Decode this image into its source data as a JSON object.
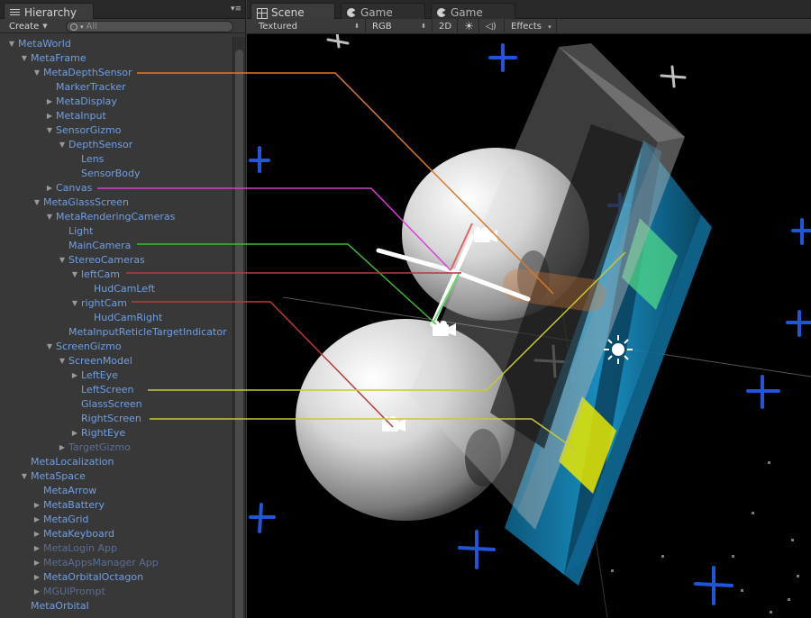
{
  "hierarchy": {
    "tab_label": "Hierarchy",
    "create_label": "Create",
    "search_placeholder": "All",
    "rows": [
      {
        "label": "MetaWorld",
        "depth": 0,
        "arrow": "open"
      },
      {
        "label": "MetaFrame",
        "depth": 1,
        "arrow": "open"
      },
      {
        "label": "MetaDepthSensor",
        "depth": 2,
        "arrow": "open"
      },
      {
        "label": "MarkerTracker",
        "depth": 3,
        "arrow": "none"
      },
      {
        "label": "MetaDisplay",
        "depth": 3,
        "arrow": "closed"
      },
      {
        "label": "MetaInput",
        "depth": 3,
        "arrow": "closed"
      },
      {
        "label": "SensorGizmo",
        "depth": 3,
        "arrow": "open"
      },
      {
        "label": "DepthSensor",
        "depth": 4,
        "arrow": "open"
      },
      {
        "label": "Lens",
        "depth": 5,
        "arrow": "none"
      },
      {
        "label": "SensorBody",
        "depth": 5,
        "arrow": "none"
      },
      {
        "label": "Canvas",
        "depth": 3,
        "arrow": "closed"
      },
      {
        "label": "MetaGlassScreen",
        "depth": 2,
        "arrow": "open"
      },
      {
        "label": "MetaRenderingCameras",
        "depth": 3,
        "arrow": "open"
      },
      {
        "label": "Light",
        "depth": 4,
        "arrow": "none"
      },
      {
        "label": "MainCamera",
        "depth": 4,
        "arrow": "none"
      },
      {
        "label": "StereoCameras",
        "depth": 4,
        "arrow": "open"
      },
      {
        "label": "leftCam",
        "depth": 5,
        "arrow": "open"
      },
      {
        "label": "HudCamLeft",
        "depth": 6,
        "arrow": "none"
      },
      {
        "label": "rightCam",
        "depth": 5,
        "arrow": "open"
      },
      {
        "label": "HudCamRight",
        "depth": 6,
        "arrow": "none"
      },
      {
        "label": "MetaInputReticleTargetIndicator",
        "depth": 4,
        "arrow": "none"
      },
      {
        "label": "ScreenGizmo",
        "depth": 3,
        "arrow": "open"
      },
      {
        "label": "ScreenModel",
        "depth": 4,
        "arrow": "open"
      },
      {
        "label": "LeftEye",
        "depth": 5,
        "arrow": "closed"
      },
      {
        "label": "LeftScreen",
        "depth": 5,
        "arrow": "none"
      },
      {
        "label": "GlassScreen",
        "depth": 5,
        "arrow": "none"
      },
      {
        "label": "RightScreen",
        "depth": 5,
        "arrow": "none"
      },
      {
        "label": "RightEye",
        "depth": 5,
        "arrow": "closed"
      },
      {
        "label": "TargetGizmo",
        "depth": 4,
        "arrow": "closed",
        "dim": true
      },
      {
        "label": "MetaLocalization",
        "depth": 1,
        "arrow": "none"
      },
      {
        "label": "MetaSpace",
        "depth": 1,
        "arrow": "open"
      },
      {
        "label": "MetaArrow",
        "depth": 2,
        "arrow": "none"
      },
      {
        "label": "MetaBattery",
        "depth": 2,
        "arrow": "closed"
      },
      {
        "label": "MetaGrid",
        "depth": 2,
        "arrow": "closed"
      },
      {
        "label": "MetaKeyboard",
        "depth": 2,
        "arrow": "closed"
      },
      {
        "label": "MetaLogin App",
        "depth": 2,
        "arrow": "closed",
        "dim": true
      },
      {
        "label": "MetaAppsManager App",
        "depth": 2,
        "arrow": "closed",
        "dim": true
      },
      {
        "label": "MetaOrbitalOctagon",
        "depth": 2,
        "arrow": "closed"
      },
      {
        "label": "MGUIPrompt",
        "depth": 2,
        "arrow": "closed",
        "dim": true
      },
      {
        "label": "MetaOrbital",
        "depth": 1,
        "arrow": "none"
      }
    ]
  },
  "scene": {
    "tabs": [
      "Scene",
      "Game",
      "Game"
    ],
    "toolbar": {
      "shading": "Textured",
      "render_mode": "RGB",
      "mode_2d": "2D",
      "effects": "Effects"
    }
  },
  "callouts": [
    {
      "row": "MetaDepthSensor",
      "color": "#d97a2a"
    },
    {
      "row": "Canvas",
      "color": "#d640d6"
    },
    {
      "row": "MainCamera",
      "color": "#44b83a"
    },
    {
      "row": "leftCam",
      "color": "#b83a3a"
    },
    {
      "row": "rightCam",
      "color": "#b83a3a"
    },
    {
      "row": "LeftScreen",
      "color": "#c8c83a"
    },
    {
      "row": "RightScreen",
      "color": "#c8c83a"
    }
  ]
}
